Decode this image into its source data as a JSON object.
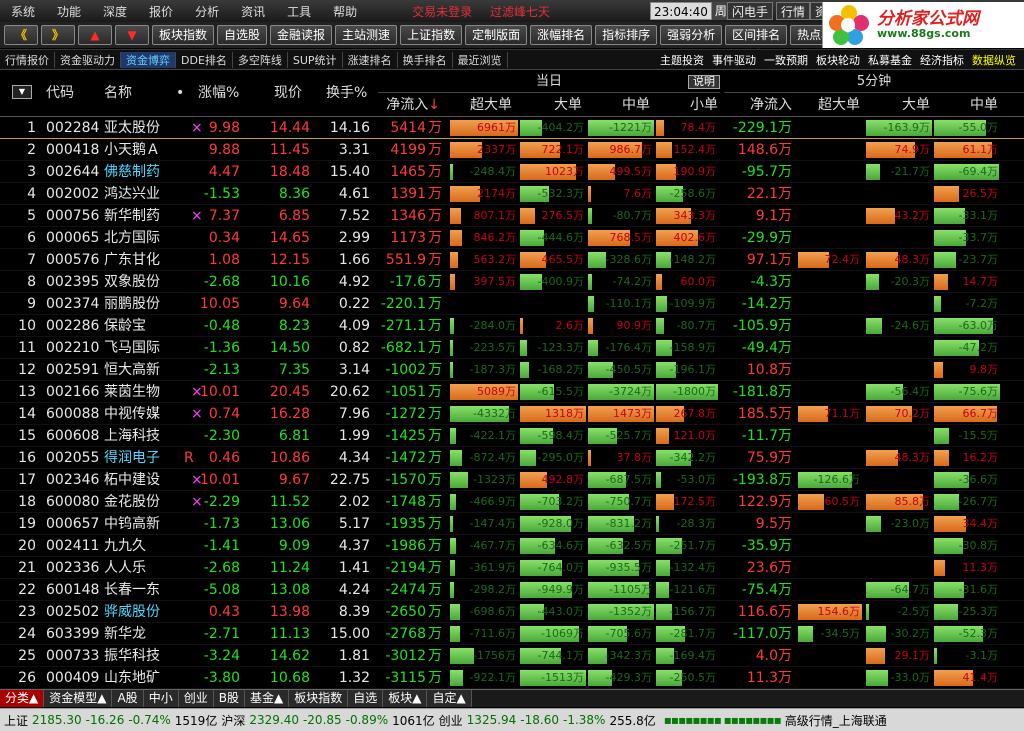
{
  "menu": [
    "系统",
    "功能",
    "深度",
    "报价",
    "分析",
    "资讯",
    "工具",
    "帮助"
  ],
  "notice": [
    "交易未登录",
    "过滤峰七天"
  ],
  "clock": {
    "time": "23:04:40",
    "day": "周五"
  },
  "top_buttons": [
    "闪电手",
    "行情",
    "资"
  ],
  "toolbar": {
    "arrows": [
      "《",
      "》",
      "▲",
      "▼"
    ],
    "buttons": [
      "板块指数",
      "自选股",
      "金融读报",
      "主站测速",
      "上证指数",
      "定制版面",
      "涨幅排名",
      "指标排序",
      "强弱分析",
      "区间排名",
      "热点板"
    ]
  },
  "logo": {
    "title": "分析家公式网",
    "url": "www.88gs.com"
  },
  "tabs": [
    "行情报价",
    "资金驱动力",
    "资金博弈",
    "DDE排名",
    "多空阵线",
    "SUP统计",
    "涨速排名",
    "换手排名",
    "最近浏览"
  ],
  "active_tab": "资金博弈",
  "right_tabs": [
    "主题投资",
    "事件驱动",
    "一致预期",
    "板块轮动",
    "私募基金",
    "经济指标",
    "数据纵览"
  ],
  "header": {
    "sort_icon": "▼",
    "code": "代码",
    "name": "名称",
    "dot": "•",
    "change": "涨幅%",
    "price": "现价",
    "turnover": "换手%",
    "group_today": "当日",
    "explain": "说明",
    "group_5min": "5分钟",
    "net": "净流入",
    "net_sort": "↓",
    "super": "超大单",
    "big": "大单",
    "mid": "中单",
    "small": "小单",
    "net5": "净流入",
    "super5": "超大单",
    "big5": "大单",
    "mid5": "中单"
  },
  "rows": [
    {
      "i": "1",
      "code": "002284",
      "name": "亚太股份",
      "flag": "×",
      "chg": "9.98",
      "price": "14.44",
      "to": "14.16",
      "net": "5414",
      "super": "6961万",
      "big": "-404.2万",
      "mid": "-1221万",
      "small": "78.4万",
      "net5": "-229.1",
      "super5": "",
      "big5": "-163.9万",
      "mid5": "-55.0万"
    },
    {
      "i": "2",
      "code": "000418",
      "name": "小天鹅Ａ",
      "flag": "",
      "chg": "9.88",
      "price": "11.45",
      "to": "3.31",
      "net": "4199",
      "super": "2337万",
      "big": "722.1万",
      "mid": "986.7万",
      "small": "152.4万",
      "net5": "148.6",
      "super5": "",
      "big5": "74.9万",
      "mid5": "61.1万"
    },
    {
      "i": "3",
      "code": "002644",
      "name": "佛慈制药",
      "flag": "",
      "chg": "4.47",
      "price": "18.48",
      "to": "15.40",
      "net": "1465",
      "super": "-248.4万",
      "big": "1023万",
      "mid": "499.5万",
      "small": "190.9万",
      "net5": "-95.7",
      "super5": "",
      "big5": "-21.7万",
      "mid5": "-69.4万"
    },
    {
      "i": "4",
      "code": "002002",
      "name": "鸿达兴业",
      "flag": "",
      "chg": "-1.53",
      "price": "8.36",
      "to": "4.61",
      "net": "1391",
      "super": "2174万",
      "big": "-532.3万",
      "mid": "7.6万",
      "small": "-258.6万",
      "net5": "22.1",
      "super5": "",
      "big5": "",
      "mid5": "26.5万"
    },
    {
      "i": "5",
      "code": "000756",
      "name": "新华制药",
      "flag": "×",
      "chg": "7.37",
      "price": "6.85",
      "to": "7.52",
      "net": "1346",
      "super": "807.1万",
      "big": "276.5万",
      "mid": "-80.7万",
      "small": "343.3万",
      "net5": "9.1",
      "super5": "",
      "big5": "43.2万",
      "mid5": "-33.1万"
    },
    {
      "i": "6",
      "code": "000065",
      "name": "北方国际",
      "flag": "",
      "chg": "0.34",
      "price": "14.65",
      "to": "2.99",
      "net": "1173",
      "super": "846.2万",
      "big": "-444.6万",
      "mid": "768.5万",
      "small": "402.6万",
      "net5": "-29.9",
      "super5": "",
      "big5": "",
      "mid5": "-33.7万"
    },
    {
      "i": "7",
      "code": "000576",
      "name": "广东甘化",
      "flag": "",
      "chg": "1.08",
      "price": "12.15",
      "to": "1.66",
      "net": "551.9",
      "super": "563.2万",
      "big": "465.5万",
      "mid": "-328.6万",
      "small": "-148.2万",
      "net5": "97.1",
      "super5": "72.4万",
      "big5": "48.3万",
      "mid5": "-23.7万"
    },
    {
      "i": "8",
      "code": "002395",
      "name": "双象股份",
      "flag": "",
      "chg": "-2.68",
      "price": "10.16",
      "to": "4.92",
      "net": "-17.6",
      "super": "397.5万",
      "big": "-400.9万",
      "mid": "-74.2万",
      "small": "60.0万",
      "net5": "-4.3",
      "super5": "",
      "big5": "-20.3万",
      "mid5": "14.7万"
    },
    {
      "i": "9",
      "code": "002374",
      "name": "丽鹏股份",
      "flag": "",
      "chg": "10.05",
      "price": "9.64",
      "to": "0.22",
      "net": "-220.1",
      "super": "",
      "big": "",
      "mid": "-110.1万",
      "small": "-109.9万",
      "net5": "-14.2",
      "super5": "",
      "big5": "",
      "mid5": "-7.2万"
    },
    {
      "i": "10",
      "code": "002286",
      "name": "保龄宝",
      "flag": "",
      "chg": "-0.48",
      "price": "8.23",
      "to": "4.09",
      "net": "-271.1",
      "super": "-284.0万",
      "big": "2.6万",
      "mid": "90.9万",
      "small": "-80.7万",
      "net5": "-105.9",
      "super5": "",
      "big5": "-24.6万",
      "mid5": "-63.0万"
    },
    {
      "i": "11",
      "code": "002210",
      "name": "飞马国际",
      "flag": "",
      "chg": "-1.36",
      "price": "14.50",
      "to": "0.82",
      "net": "-682.1",
      "super": "-223.5万",
      "big": "-123.3万",
      "mid": "-176.4万",
      "small": "-158.9万",
      "net5": "-49.4",
      "super5": "",
      "big5": "",
      "mid5": "-47.2万"
    },
    {
      "i": "12",
      "code": "002591",
      "name": "恒大高新",
      "flag": "",
      "chg": "-2.13",
      "price": "7.35",
      "to": "3.14",
      "net": "-1002",
      "super": "-187.3万",
      "big": "-168.2万",
      "mid": "-450.5万",
      "small": "-196.1万",
      "net5": "10.8",
      "super5": "",
      "big5": "",
      "mid5": "9.8万"
    },
    {
      "i": "13",
      "code": "002166",
      "name": "莱茵生物",
      "flag": "×",
      "chg": "10.01",
      "price": "20.45",
      "to": "20.62",
      "net": "-1051",
      "super": "5089万",
      "big": "-615.5万",
      "mid": "-3724万",
      "small": "-1800万",
      "net5": "-181.8",
      "super5": "",
      "big5": "-56.4万",
      "mid5": "-75.6万"
    },
    {
      "i": "14",
      "code": "600088",
      "name": "中视传媒",
      "flag": "×",
      "chg": "0.74",
      "price": "16.28",
      "to": "7.96",
      "net": "-1272",
      "super": "-4332万",
      "big": "1318万",
      "mid": "1473万",
      "small": "267.8万",
      "net5": "185.5",
      "super5": "71.1万",
      "big5": "70.2万",
      "mid5": "66.7万"
    },
    {
      "i": "15",
      "code": "600608",
      "name": "上海科技",
      "flag": "",
      "chg": "-2.30",
      "price": "6.81",
      "to": "1.99",
      "net": "-1425",
      "super": "-422.1万",
      "big": "-598.4万",
      "mid": "-525.7万",
      "small": "121.0万",
      "net5": "-11.7",
      "super5": "",
      "big5": "",
      "mid5": "-15.5万"
    },
    {
      "i": "16",
      "code": "002055",
      "name": "得润电子",
      "flag": "R",
      "chg": "0.46",
      "price": "10.86",
      "to": "4.34",
      "net": "-1472",
      "super": "-872.4万",
      "big": "-295.0万",
      "mid": "37.8万",
      "small": "-342.2万",
      "net5": "75.9",
      "super5": "",
      "big5": "48.3万",
      "mid5": "16.2万"
    },
    {
      "i": "17",
      "code": "002346",
      "name": "柘中建设",
      "flag": "×",
      "chg": "10.01",
      "price": "9.67",
      "to": "22.75",
      "net": "-1570",
      "super": "-1323万",
      "big": "492.8万",
      "mid": "-687.5万",
      "small": "-53.0万",
      "net5": "-193.8",
      "super5": "-126.6万",
      "big5": "",
      "mid5": "-36.6万"
    },
    {
      "i": "18",
      "code": "600080",
      "name": "金花股份",
      "flag": "×",
      "chg": "-2.29",
      "price": "11.52",
      "to": "2.02",
      "net": "-1748",
      "super": "-466.9万",
      "big": "-703.2万",
      "mid": "-750.7万",
      "small": "172.5万",
      "net5": "122.9",
      "super5": "60.5万",
      "big5": "85.8万",
      "mid5": "-26.7万"
    },
    {
      "i": "19",
      "code": "000657",
      "name": "中钨高新",
      "flag": "",
      "chg": "-1.73",
      "price": "13.06",
      "to": "5.17",
      "net": "-1935",
      "super": "-147.4万",
      "big": "-928.0万",
      "mid": "-831.2万",
      "small": "-28.3万",
      "net5": "9.5",
      "super5": "",
      "big5": "-23.0万",
      "mid5": "34.4万"
    },
    {
      "i": "20",
      "code": "002411",
      "name": "九九久",
      "flag": "",
      "chg": "-1.41",
      "price": "9.09",
      "to": "4.37",
      "net": "-1986",
      "super": "-467.7万",
      "big": "-634.6万",
      "mid": "-632.5万",
      "small": "-251.7万",
      "net5": "-35.9",
      "super5": "",
      "big5": "",
      "mid5": "-30.8万"
    },
    {
      "i": "21",
      "code": "002336",
      "name": "人人乐",
      "flag": "",
      "chg": "-2.68",
      "price": "11.24",
      "to": "1.41",
      "net": "-2194",
      "super": "-361.9万",
      "big": "-764.0万",
      "mid": "-935.5万",
      "small": "-132.4万",
      "net5": "23.6",
      "super5": "",
      "big5": "",
      "mid5": "11.3万"
    },
    {
      "i": "22",
      "code": "600148",
      "name": "长春一东",
      "flag": "",
      "chg": "-5.08",
      "price": "13.08",
      "to": "4.24",
      "net": "-2474",
      "super": "-298.2万",
      "big": "-949.9万",
      "mid": "-1105万",
      "small": "-121.6万",
      "net5": "-75.4",
      "super5": "",
      "big5": "-64.7万",
      "mid5": "-31.6万"
    },
    {
      "i": "23",
      "code": "002502",
      "name": "骅威股份",
      "flag": "",
      "chg": "0.43",
      "price": "13.98",
      "to": "8.39",
      "net": "-2650",
      "super": "-698.6万",
      "big": "-443.0万",
      "mid": "-1352万",
      "small": "-156.7万",
      "net5": "116.6",
      "super5": "154.6万",
      "big5": "-2.5万",
      "mid5": "-25.3万"
    },
    {
      "i": "24",
      "code": "603399",
      "name": "新华龙",
      "flag": "",
      "chg": "-2.71",
      "price": "11.13",
      "to": "15.00",
      "net": "-2768",
      "super": "-711.6万",
      "big": "-1069万",
      "mid": "-705.6万",
      "small": "-281.7万",
      "net5": "-117.0",
      "super5": "-34.5万",
      "big5": "-30.2万",
      "mid5": "-52.3万"
    },
    {
      "i": "25",
      "code": "000733",
      "name": "振华科技",
      "flag": "",
      "chg": "-3.24",
      "price": "14.62",
      "to": "1.81",
      "net": "-3012",
      "super": "-1756万",
      "big": "-744.1万",
      "mid": "-342.3万",
      "small": "-169.4万",
      "net5": "4.0",
      "super5": "",
      "big5": "29.1万",
      "mid5": "-3.1万"
    },
    {
      "i": "26",
      "code": "000409",
      "name": "山东地矿",
      "flag": "",
      "chg": "-3.80",
      "price": "10.68",
      "to": "1.32",
      "net": "-3115",
      "super": "-922.1万",
      "big": "-1513万",
      "mid": "-429.3万",
      "small": "-250.5万",
      "net5": "11.3",
      "super5": "",
      "big5": "-33.0万",
      "mid5": "41.4万"
    }
  ],
  "bottom_tabs": [
    "分类▲",
    "资金模型▲",
    "A股",
    "中小",
    "创业",
    "B股",
    "基金▲",
    "板块指数",
    "自选",
    "板块▲",
    "自定▲"
  ],
  "status": {
    "sh_label": "上证",
    "sh_val": "2185.30",
    "sh_chg": "-16.26",
    "sh_pct": "-0.74%",
    "sh_amt": "1519亿",
    "sz_label": "沪深",
    "sz_val": "2329.40",
    "sz_chg": "-20.85",
    "sz_pct": "-0.89%",
    "sz_amt": "1061亿",
    "cy_label": "创业",
    "cy_val": "1325.94",
    "cy_chg": "-18.60",
    "cy_pct": "-1.38%",
    "cy_amt": "255.8亿",
    "blocks": "▪▪▪▪▪▪▪▪ ▪▪▪▪▪▪▪▪",
    "feed": "高级行情_上海联通"
  },
  "colors": {
    "up": "#ff3a3a",
    "down": "#22e022",
    "orange": "#e88a30",
    "green_bar": "#6ac850"
  }
}
